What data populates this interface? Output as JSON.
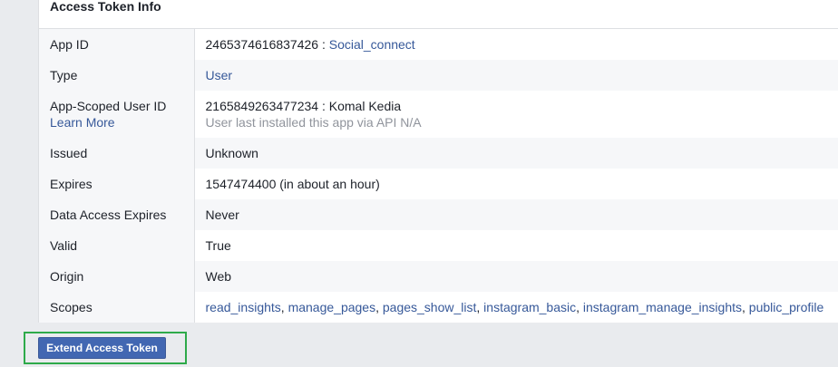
{
  "panel": {
    "title": "Access Token Info"
  },
  "rows": {
    "app_id": {
      "label": "App ID",
      "id": "2465374616837426",
      "separator": " : ",
      "app_name": "Social_connect"
    },
    "type": {
      "label": "Type",
      "value": "User"
    },
    "user_id": {
      "label": "App-Scoped User ID",
      "learn_more": "Learn More",
      "id": "2165849263477234",
      "separator": " : ",
      "user_name": "Komal Kedia",
      "install_note": "User last installed this app via API N/A"
    },
    "issued": {
      "label": "Issued",
      "value": "Unknown"
    },
    "expires": {
      "label": "Expires",
      "value": "1547474400 (in about an hour)"
    },
    "data_access_expires": {
      "label": "Data Access Expires",
      "value": "Never"
    },
    "valid": {
      "label": "Valid",
      "value": "True"
    },
    "origin": {
      "label": "Origin",
      "value": "Web"
    },
    "scopes": {
      "label": "Scopes",
      "separator": ", ",
      "items": [
        "read_insights",
        "manage_pages",
        "pages_show_list",
        "instagram_basic",
        "instagram_manage_insights",
        "public_profile"
      ]
    }
  },
  "actions": {
    "extend_label": "Extend Access Token"
  },
  "colors": {
    "link": "#365899",
    "button_bg": "#4267b2",
    "highlight_border": "#2eaa4a",
    "label_bg": "#f6f7f9"
  }
}
